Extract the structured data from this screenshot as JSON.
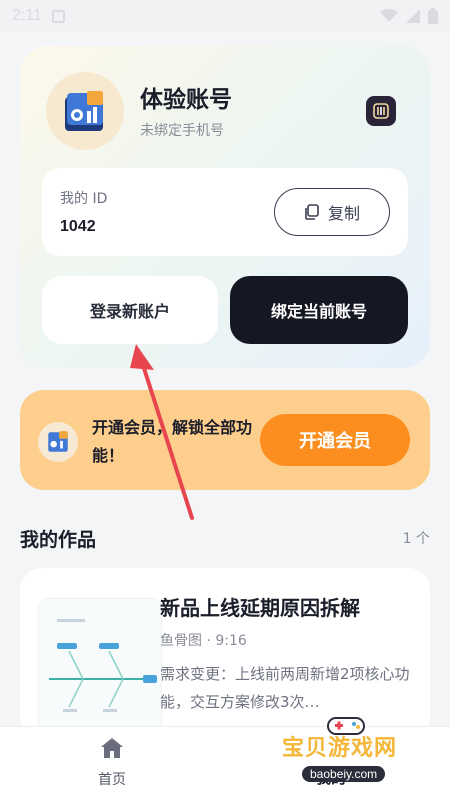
{
  "status_bar": {
    "time": "2:11"
  },
  "profile": {
    "name": "体验账号",
    "phone_hint": "未绑定手机号",
    "id_label": "我的 ID",
    "id_value": "1042",
    "copy_label": "复制",
    "login_new_label": "登录新账户",
    "bind_current_label": "绑定当前账号"
  },
  "vip": {
    "promo_text": "开通会员，解锁全部功能！",
    "button_label": "开通会员"
  },
  "works": {
    "section_title": "我的作品",
    "count": "1 个",
    "items": [
      {
        "title": "新品上线延期原因拆解",
        "meta": "鱼骨图 · 9:16",
        "description": "需求变更：上线前两周新增2项核心功能，交互方案修改3次…"
      }
    ]
  },
  "tabs": {
    "home_label": "首页",
    "mine_label": "我的"
  },
  "watermark": {
    "brand": "宝贝游戏网",
    "url": "baobeiy.com"
  },
  "colors": {
    "accent_orange": "#fb8e1e",
    "vip_bg": "#fecf8c",
    "dark_button": "#151723",
    "arrow_red": "#e8464f"
  },
  "icons": {
    "settings": "settings-icon",
    "copy": "copy-icon",
    "home": "home-icon",
    "app_logo": "app-logo-icon"
  }
}
